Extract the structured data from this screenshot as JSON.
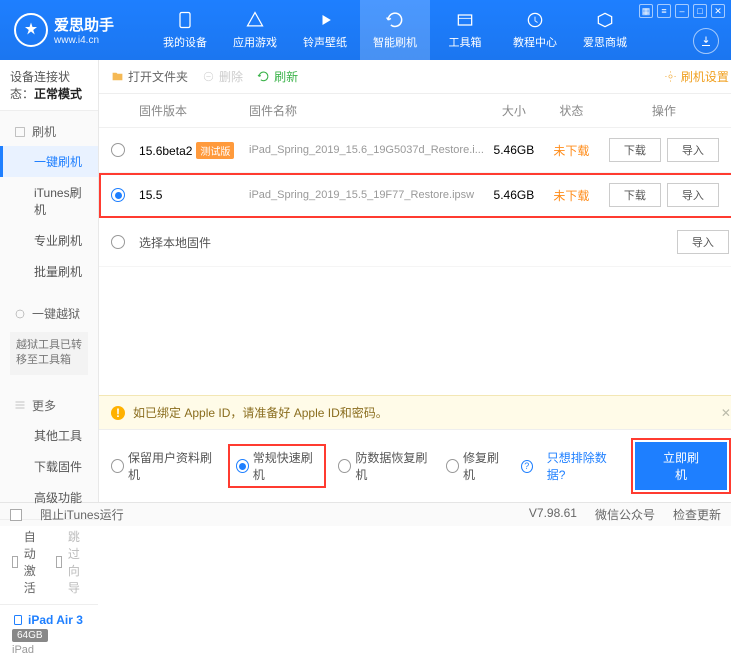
{
  "app": {
    "name": "爱思助手",
    "url": "www.i4.cn"
  },
  "nav": {
    "items": [
      "我的设备",
      "应用游戏",
      "铃声壁纸",
      "智能刷机",
      "工具箱",
      "教程中心",
      "爱思商城"
    ],
    "activeIndex": 3
  },
  "sidebar": {
    "statusLabel": "设备连接状态：",
    "statusValue": "正常模式",
    "flash": {
      "head": "刷机",
      "items": [
        "一键刷机",
        "iTunes刷机",
        "专业刷机",
        "批量刷机"
      ],
      "activeIndex": 0
    },
    "jail": {
      "head": "一键越狱",
      "note": "越狱工具已转移至工具箱"
    },
    "more": {
      "head": "更多",
      "items": [
        "其他工具",
        "下载固件",
        "高级功能"
      ]
    },
    "autoActivate": "自动激活",
    "skipGuide": "跳过向导",
    "device": {
      "name": "iPad Air 3",
      "capacity": "64GB",
      "type": "iPad"
    }
  },
  "toolbar": {
    "open": "打开文件夹",
    "delete": "删除",
    "refresh": "刷新",
    "settings": "刷机设置"
  },
  "table": {
    "headers": {
      "ver": "固件版本",
      "name": "固件名称",
      "size": "大小",
      "status": "状态",
      "op": "操作"
    },
    "rows": [
      {
        "ver": "15.6beta2",
        "tag": "测试版",
        "name": "iPad_Spring_2019_15.6_19G5037d_Restore.i...",
        "size": "5.46GB",
        "status": "未下载",
        "selected": false
      },
      {
        "ver": "15.5",
        "tag": "",
        "name": "iPad_Spring_2019_15.5_19F77_Restore.ipsw",
        "size": "5.46GB",
        "status": "未下载",
        "selected": true
      }
    ],
    "local": "选择本地固件",
    "btnDownload": "下载",
    "btnImport": "导入"
  },
  "warn": "如已绑定 Apple ID，请准备好 Apple ID和密码。",
  "modes": {
    "keep": "保留用户资料刷机",
    "normal": "常规快速刷机",
    "recover": "防数据恢复刷机",
    "repair": "修复刷机",
    "exclude": "只想排除数据?",
    "flash": "立即刷机"
  },
  "statusbar": {
    "block": "阻止iTunes运行",
    "version": "V7.98.61",
    "wechat": "微信公众号",
    "check": "检查更新"
  }
}
